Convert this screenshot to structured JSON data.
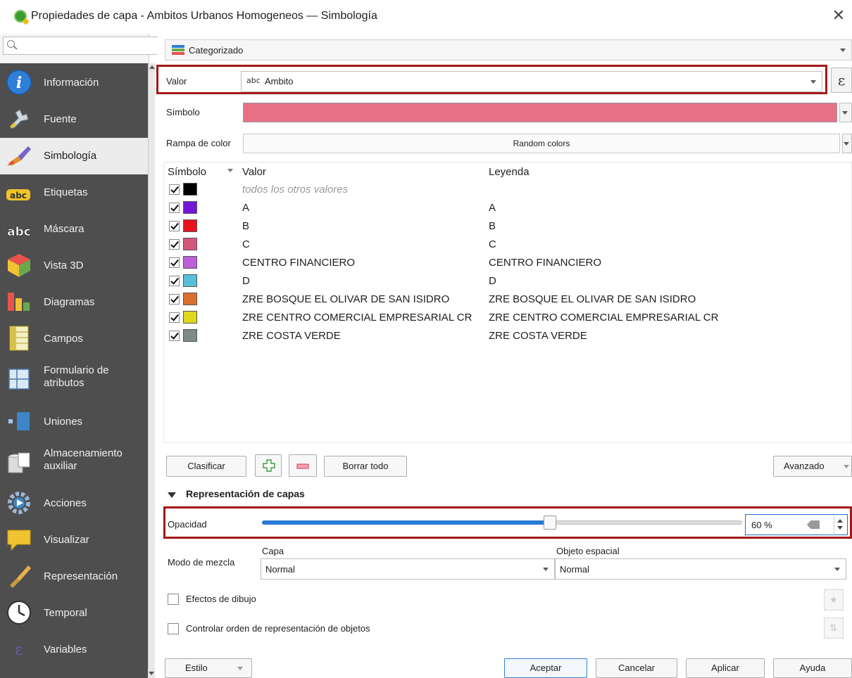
{
  "window": {
    "title": "Propiedades de capa - Ambitos Urbanos Homogeneos — Simbología",
    "close_symbol": "✕"
  },
  "sidebar": {
    "search_placeholder": "",
    "items": [
      {
        "label": "Información",
        "icon": "info-icon"
      },
      {
        "label": "Fuente",
        "icon": "source-icon"
      },
      {
        "label": "Simbología",
        "icon": "symbology-brush-icon",
        "active": true
      },
      {
        "label": "Etiquetas",
        "icon": "labels-abc-icon"
      },
      {
        "label": "Máscara",
        "icon": "mask-abc-icon"
      },
      {
        "label": "Vista 3D",
        "icon": "cube-3d-icon"
      },
      {
        "label": "Diagramas",
        "icon": "diagrams-icon"
      },
      {
        "label": "Campos",
        "icon": "fields-icon"
      },
      {
        "label": "Formulario de atributos",
        "icon": "attributes-form-icon"
      },
      {
        "label": "Uniones",
        "icon": "joins-icon"
      },
      {
        "label": "Almacenamiento auxiliar",
        "icon": "auxiliary-storage-icon"
      },
      {
        "label": "Acciones",
        "icon": "actions-gear-icon"
      },
      {
        "label": "Visualizar",
        "icon": "display-speech-icon"
      },
      {
        "label": "Representación",
        "icon": "rendering-brush-icon"
      },
      {
        "label": "Temporal",
        "icon": "clock-icon"
      },
      {
        "label": "Variables",
        "icon": "variables-icon"
      }
    ]
  },
  "renderer": {
    "type_label": "Categorizado"
  },
  "fields": {
    "valor_label": "Valor",
    "valor_type_tag": "abc",
    "valor_value": "Ambito",
    "expression_symbol": "ε",
    "simbolo_label": "Símbolo",
    "simbolo_color": "#e77087",
    "rampa_label": "Rampa de color",
    "rampa_value": "Random colors"
  },
  "table": {
    "headers": {
      "symbol": "Símbolo",
      "valor": "Valor",
      "leyenda": "Leyenda"
    },
    "rows": [
      {
        "color": "#000000",
        "valor": "todos los otros valores",
        "leyenda": "",
        "placeholder": true
      },
      {
        "color": "#7216d8",
        "valor": "A",
        "leyenda": "A"
      },
      {
        "color": "#e8131c",
        "valor": "B",
        "leyenda": "B"
      },
      {
        "color": "#d3577c",
        "valor": "C",
        "leyenda": "C"
      },
      {
        "color": "#bd5fd8",
        "valor": "CENTRO FINANCIERO",
        "leyenda": "CENTRO FINANCIERO"
      },
      {
        "color": "#58bfda",
        "valor": "D",
        "leyenda": "D"
      },
      {
        "color": "#d9702f",
        "valor": "ZRE BOSQUE EL OLIVAR DE SAN ISIDRO",
        "leyenda": "ZRE BOSQUE EL OLIVAR DE SAN ISIDRO"
      },
      {
        "color": "#dfd81c",
        "valor": "ZRE CENTRO COMERCIAL EMPRESARIAL CR",
        "leyenda": "ZRE CENTRO COMERCIAL EMPRESARIAL CR"
      },
      {
        "color": "#7f8b89",
        "valor": "ZRE COSTA VERDE",
        "leyenda": "ZRE COSTA VERDE"
      }
    ]
  },
  "class_buttons": {
    "clasificar": "Clasificar",
    "borrar_todo": "Borrar todo",
    "avanzado": "Avanzado"
  },
  "layer_rendering": {
    "section_title": "Representación de capas",
    "opacity_label": "Opacidad",
    "opacity_value": "60 %",
    "opacity_fraction": 0.6,
    "blend_label": "Modo de mezcla",
    "layer_label": "Capa",
    "layer_value": "Normal",
    "feature_label": "Objeto espacial",
    "feature_value": "Normal",
    "draw_effects_label": "Efectos de dibujo",
    "render_order_label": "Controlar orden de representación de objetos"
  },
  "footer": {
    "estilo": "Estilo",
    "aceptar": "Aceptar",
    "cancelar": "Cancelar",
    "aplicar": "Aplicar",
    "ayuda": "Ayuda"
  }
}
